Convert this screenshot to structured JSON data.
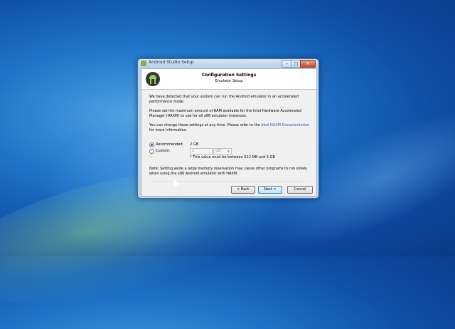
{
  "window": {
    "title": "Android Studio Setup",
    "controls": {
      "minimize": "–",
      "maximize": "□",
      "close": "✕"
    }
  },
  "header": {
    "title": "Configuration Settings",
    "subtitle": "Emulator Setup"
  },
  "body": {
    "para1": "We have detected that your system can run the Android emulator in an accelerated performance mode.",
    "para2": "Please set the maximum amount of RAM available for the Intel Hardware Accelerated Manager (HAXM) to use for all x86 emulator instances.",
    "para3_prefix": "You can change these settings at any time. Please refer to the ",
    "para3_link": "Intel HAXM Documentation",
    "para3_suffix": " for more information."
  },
  "options": {
    "recommended_label": "Recommended:",
    "recommended_value": "2 GB",
    "custom_label": "Custom:",
    "custom_value": "2",
    "custom_unit": "GB",
    "selected": "recommended",
    "hint": "* This value must be between 512 MB and 5 GB"
  },
  "note": "Note: Setting aside a large memory reservation may cause other programs to run slowly when using the x86 Android emulator with HAXM.",
  "buttons": {
    "back": "< Back",
    "next": "Next >",
    "cancel": "Cancel"
  },
  "icons": {
    "app_icon": "android-studio-icon",
    "unit_dropdown": "chevron-down-icon"
  },
  "colors": {
    "link": "#1a56c4",
    "accent": "#9ccc65"
  }
}
